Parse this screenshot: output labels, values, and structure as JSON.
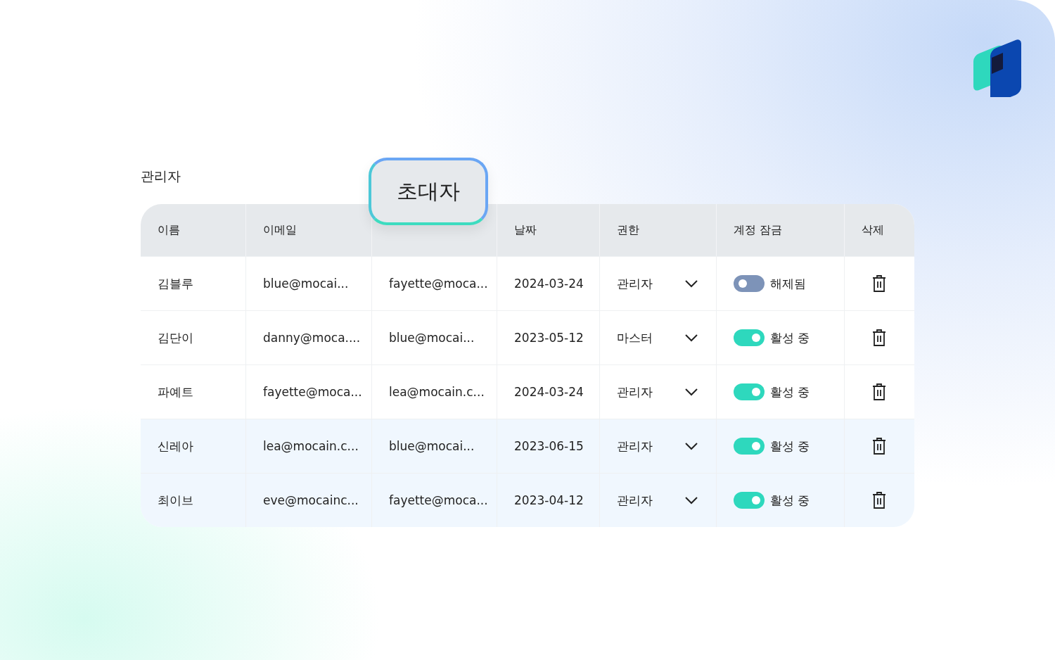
{
  "section_title": "관리자",
  "table": {
    "columns": [
      {
        "label": "이름",
        "kind": "plain"
      },
      {
        "label": "이메일",
        "kind": "plain"
      },
      {
        "label": "초대자",
        "kind": "floating"
      },
      {
        "label": "날짜",
        "kind": "plain"
      },
      {
        "label": "권한",
        "kind": "plain"
      },
      {
        "label": "계정 잠금",
        "kind": "plain"
      },
      {
        "label": "삭제",
        "kind": "plain"
      }
    ],
    "rows": [
      {
        "name": "김블루",
        "email": "blue@mocai...",
        "inviter": "fayette@moca...",
        "date": "2024-03-24",
        "role": "관리자",
        "lock_on": false,
        "lock_label": "해제됨"
      },
      {
        "name": "김단이",
        "email": "danny@moca....",
        "inviter": "blue@mocai...",
        "date": "2023-05-12",
        "role": "마스터",
        "lock_on": true,
        "lock_label": "활성 중"
      },
      {
        "name": "파예트",
        "email": "fayette@moca...",
        "inviter": "lea@mocain.c...",
        "date": "2024-03-24",
        "role": "관리자",
        "lock_on": true,
        "lock_label": "활성 중"
      },
      {
        "name": "신레아",
        "email": "lea@mocain.c...",
        "inviter": "blue@mocai...",
        "date": "2023-06-15",
        "role": "관리자",
        "lock_on": true,
        "lock_label": "활성 중"
      },
      {
        "name": "최이브",
        "email": "eve@mocainc...",
        "inviter": "fayette@moca...",
        "date": "2023-04-12",
        "role": "관리자",
        "lock_on": true,
        "lock_label": "활성 중"
      }
    ]
  }
}
